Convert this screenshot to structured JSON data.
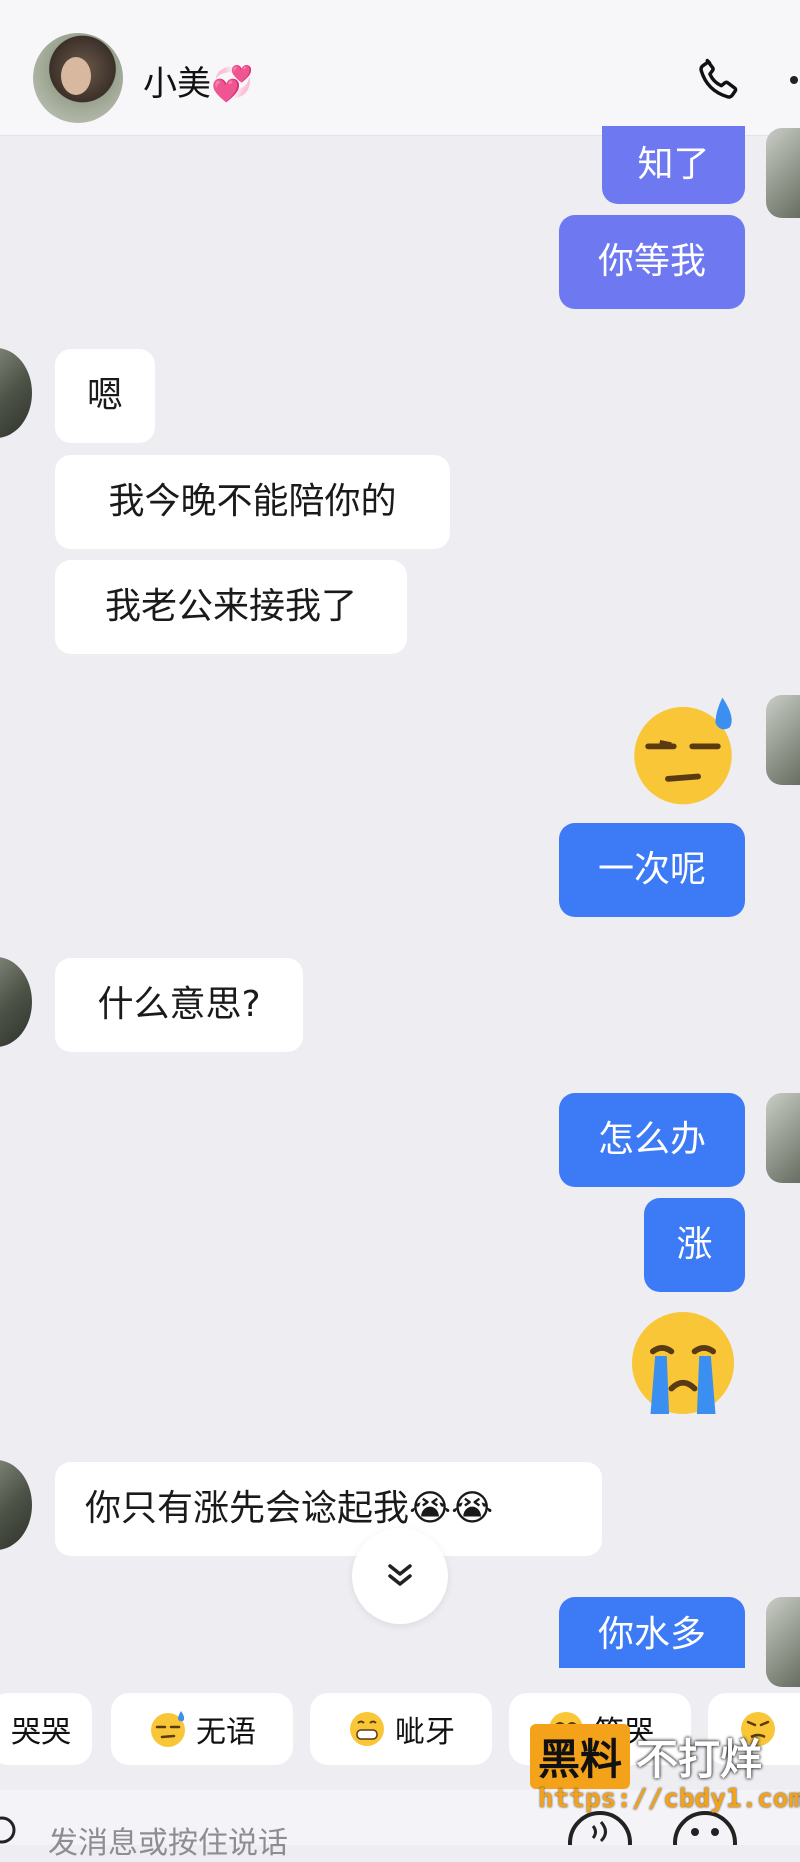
{
  "header": {
    "contact_name": "小美💞"
  },
  "messages": [
    {
      "text": "知了"
    },
    {
      "text": "你等我"
    },
    {
      "text": "嗯"
    },
    {
      "text": "我今晚不能陪你的"
    },
    {
      "text": "我老公来接我了"
    },
    {
      "emoji": "speechless-sweat-emoji"
    },
    {
      "text": "一次呢"
    },
    {
      "text": "什么意思?"
    },
    {
      "text": "怎么办"
    },
    {
      "text": "涨"
    },
    {
      "emoji": "crying-emoji"
    },
    {
      "text": "你只有涨先会谂起我😭😭"
    },
    {
      "text": "你水多"
    }
  ],
  "quick_replies": [
    "哭哭",
    "无语",
    "呲牙",
    "笑哭"
  ],
  "input": {
    "placeholder": "发消息或按住说话"
  },
  "watermark": {
    "brand": "黑料",
    "tagline": "不打烊",
    "url": "https://cbdy1.com"
  }
}
